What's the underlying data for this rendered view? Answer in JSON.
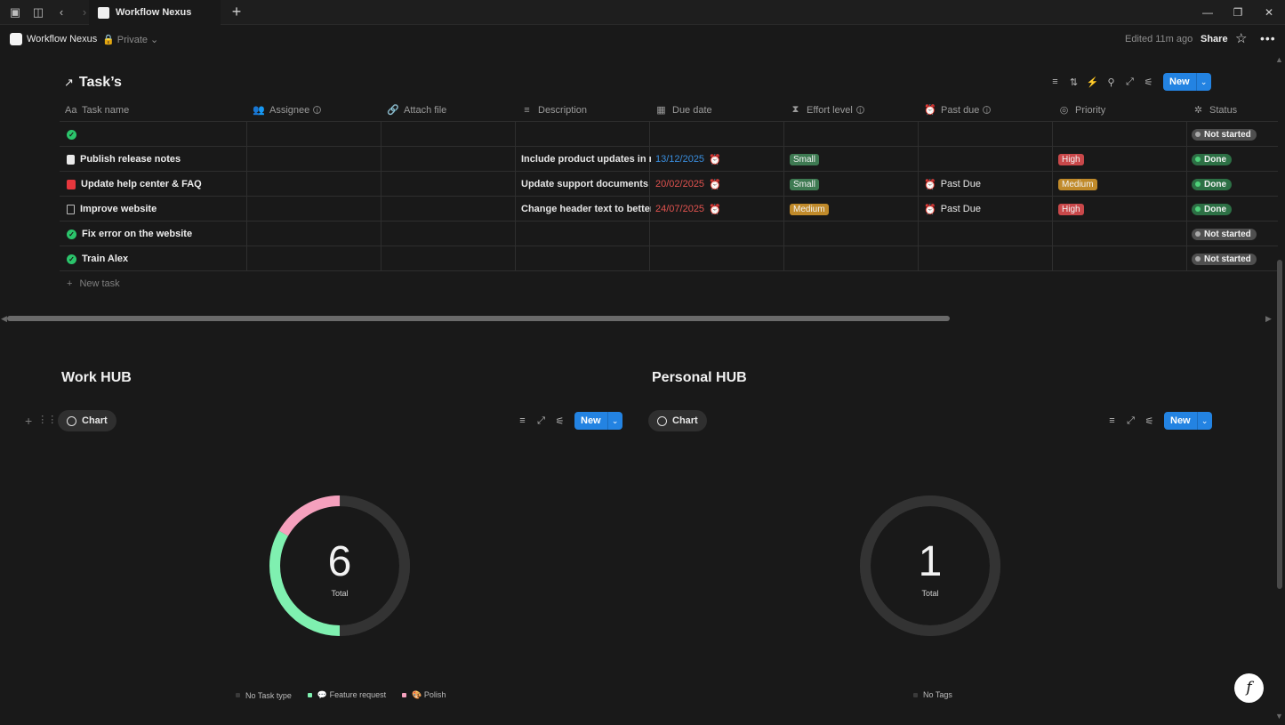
{
  "window": {
    "tab_title": "Workflow Nexus",
    "new_tab": "+",
    "minimize": "—",
    "restore": "❐",
    "close": "✕"
  },
  "header": {
    "workspace": "Workflow Nexus",
    "privacy": "🔒 Private ⌄",
    "edited": "Edited 11m ago",
    "share": "Share",
    "star": "☆",
    "more": "•••"
  },
  "tasks": {
    "title": "Task’s",
    "arrow": "↗",
    "new_label": "New",
    "new_dd": "⌄",
    "new_task": "New task",
    "columns": [
      {
        "label": "Task name",
        "icon": "Aa"
      },
      {
        "label": "Assignee",
        "icon": "👥"
      },
      {
        "label": "Attach file",
        "icon": "🔗"
      },
      {
        "label": "Description",
        "icon": "≡"
      },
      {
        "label": "Due date",
        "icon": "▦"
      },
      {
        "label": "Effort level",
        "icon": "⧗"
      },
      {
        "label": "Past due",
        "icon": "⏰"
      },
      {
        "label": "Priority",
        "icon": "◎"
      },
      {
        "label": "Status",
        "icon": "✲"
      }
    ],
    "rows": [
      {
        "name": "",
        "desc": "",
        "due": "",
        "effort": "",
        "past_due": "",
        "priority": "",
        "status": "Not started"
      },
      {
        "name": "Publish release notes",
        "desc": "Include product updates in next",
        "due": "13/12/2025",
        "effort": "Small",
        "past_due": "",
        "priority": "High",
        "status": "Done"
      },
      {
        "name": "Update help center & FAQ",
        "desc": "Update support documents to reflect",
        "due": "20/02/2025",
        "effort": "Small",
        "past_due": "Past Due",
        "priority": "Medium",
        "status": "Done"
      },
      {
        "name": "Improve website",
        "desc": "Change header text to better reflect",
        "due": "24/07/2025",
        "effort": "Medium",
        "past_due": "Past Due",
        "priority": "High",
        "status": "Done"
      },
      {
        "name": "Fix error on the website",
        "desc": "",
        "due": "",
        "effort": "",
        "past_due": "",
        "priority": "",
        "status": "Not started"
      },
      {
        "name": "Train Alex",
        "desc": "",
        "due": "",
        "effort": "",
        "past_due": "",
        "priority": "",
        "status": "Not started"
      }
    ]
  },
  "work_hub": {
    "title": "Work HUB",
    "tab": "Chart",
    "new_label": "New",
    "total": "6",
    "total_label": "Total",
    "legend": [
      {
        "label": "No Task type",
        "color": "#3a3a3a"
      },
      {
        "label": "💬 Feature request",
        "color": "#7ff0b0"
      },
      {
        "label": "🎨 Polish",
        "color": "#f5a0bd"
      }
    ]
  },
  "personal_hub": {
    "title": "Personal HUB",
    "tab": "Chart",
    "new_label": "New",
    "total": "1",
    "total_label": "Total",
    "legend": [
      {
        "label": "No Tags",
        "color": "#3a3a3a"
      }
    ]
  },
  "chart_data": [
    {
      "type": "pie",
      "categories": [
        "No Task type",
        "Feature request",
        "Polish"
      ],
      "values": [
        3,
        2,
        1
      ]
    },
    {
      "type": "pie",
      "categories": [
        "No Tags"
      ],
      "values": [
        1
      ]
    }
  ],
  "colors": {
    "accent": "#2383e2",
    "background": "#191919"
  }
}
